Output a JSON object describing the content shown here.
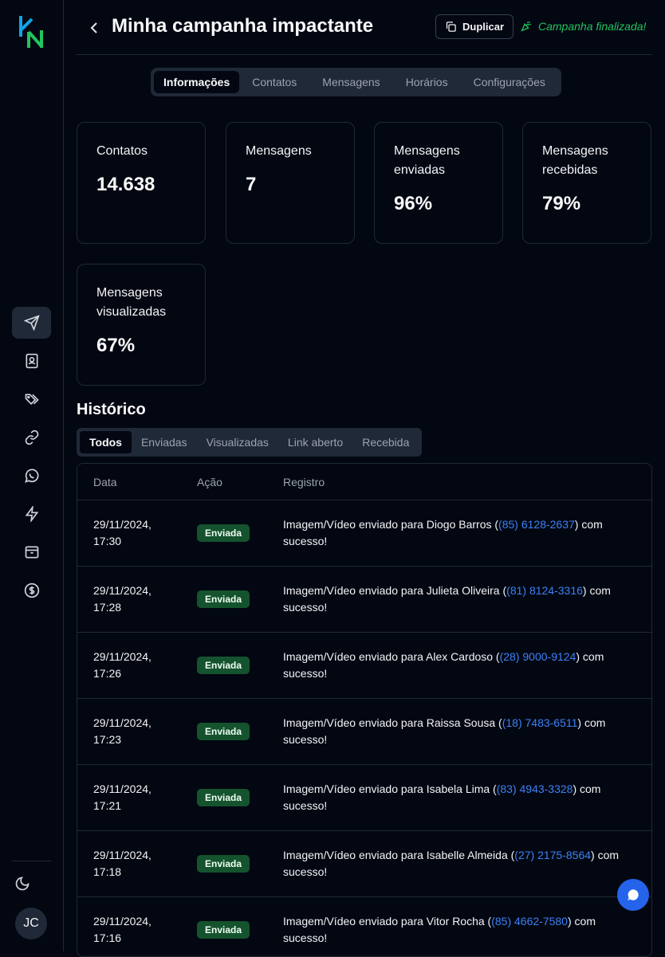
{
  "header": {
    "title": "Minha campanha impactante",
    "duplicate_label": "Duplicar",
    "status_text": "Campanha finalizada!"
  },
  "tabs": [
    "Informações",
    "Contatos",
    "Mensagens",
    "Horários",
    "Configurações"
  ],
  "stats": [
    {
      "label": "Contatos",
      "value": "14.638"
    },
    {
      "label": "Mensagens",
      "value": "7"
    },
    {
      "label": "Mensagens enviadas",
      "value": "96%"
    },
    {
      "label": "Mensagens recebidas",
      "value": "79%"
    },
    {
      "label": "Mensagens visualizadas",
      "value": "67%"
    }
  ],
  "history": {
    "title": "Histórico",
    "filters": [
      "Todos",
      "Enviadas",
      "Visualizadas",
      "Link aberto",
      "Recebida"
    ],
    "columns": [
      "Data",
      "Ação",
      "Registro"
    ],
    "rows": [
      {
        "date": "29/11/2024, 17:30",
        "action": "Enviada",
        "prefix": "Imagem/Vídeo enviado para Diogo Barros (",
        "phone": "(85) 6128-2637",
        "suffix": ") com sucesso!"
      },
      {
        "date": "29/11/2024, 17:28",
        "action": "Enviada",
        "prefix": "Imagem/Vídeo enviado para Julieta Oliveira (",
        "phone": "(81) 8124-3316",
        "suffix": ") com sucesso!"
      },
      {
        "date": "29/11/2024, 17:26",
        "action": "Enviada",
        "prefix": "Imagem/Vídeo enviado para Alex Cardoso (",
        "phone": "(28) 9000-9124",
        "suffix": ") com sucesso!"
      },
      {
        "date": "29/11/2024, 17:23",
        "action": "Enviada",
        "prefix": "Imagem/Vídeo enviado para Raissa Sousa (",
        "phone": "(18) 7483-6511",
        "suffix": ") com sucesso!"
      },
      {
        "date": "29/11/2024, 17:21",
        "action": "Enviada",
        "prefix": "Imagem/Vídeo enviado para Isabela Lima (",
        "phone": "(83) 4943-3328",
        "suffix": ") com sucesso!"
      },
      {
        "date": "29/11/2024, 17:18",
        "action": "Enviada",
        "prefix": "Imagem/Vídeo enviado para Isabelle Almeida (",
        "phone": "(27) 2175-8564",
        "suffix": ") com sucesso!"
      },
      {
        "date": "29/11/2024, 17:16",
        "action": "Enviada",
        "prefix": "Imagem/Vídeo enviado para Vitor Rocha (",
        "phone": "(85) 4662-7580",
        "suffix": ") com sucesso!"
      }
    ]
  },
  "user": {
    "initials": "JC"
  },
  "icons": {
    "nav": [
      "send-icon",
      "contacts-book-icon",
      "tags-icon",
      "link-icon",
      "whatsapp-icon",
      "lightning-icon",
      "archive-icon",
      "dollar-icon"
    ],
    "theme": "moon-icon",
    "chat": "chat-bubble-icon"
  },
  "colors": {
    "background": "#030712",
    "accent_green": "#22c55e",
    "badge_green": "#14532d",
    "link_blue": "#3b82f6",
    "chat_blue": "#2563eb"
  }
}
